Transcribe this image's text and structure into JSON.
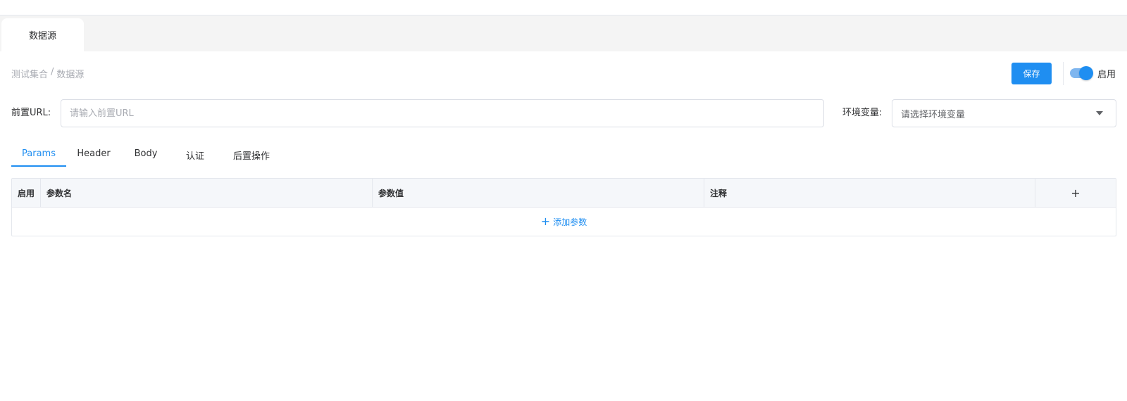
{
  "page_tab": {
    "label": "数据源"
  },
  "breadcrumb": {
    "parent": "测试集合",
    "separator": "/",
    "current": "数据源"
  },
  "actions": {
    "save_label": "保存",
    "enable_label": "启用",
    "enabled": true
  },
  "form": {
    "url_label": "前置URL:",
    "url_placeholder": "请输入前置URL",
    "env_label": "环境变量:",
    "env_placeholder": "请选择环境变量"
  },
  "tabs": [
    {
      "label": "Params",
      "active": true
    },
    {
      "label": "Header",
      "active": false
    },
    {
      "label": "Body",
      "active": false
    },
    {
      "label": "认证",
      "active": false
    },
    {
      "label": "后置操作",
      "active": false
    }
  ],
  "table": {
    "headers": [
      "启用",
      "参数名",
      "参数值",
      "注释",
      "+"
    ],
    "add_label": "添加参数",
    "add_icon": "plus-icon"
  },
  "colors": {
    "accent": "#1f8ef1",
    "header_bg": "#f5f7fa",
    "tab_strip_bg": "#f4f4f4"
  }
}
